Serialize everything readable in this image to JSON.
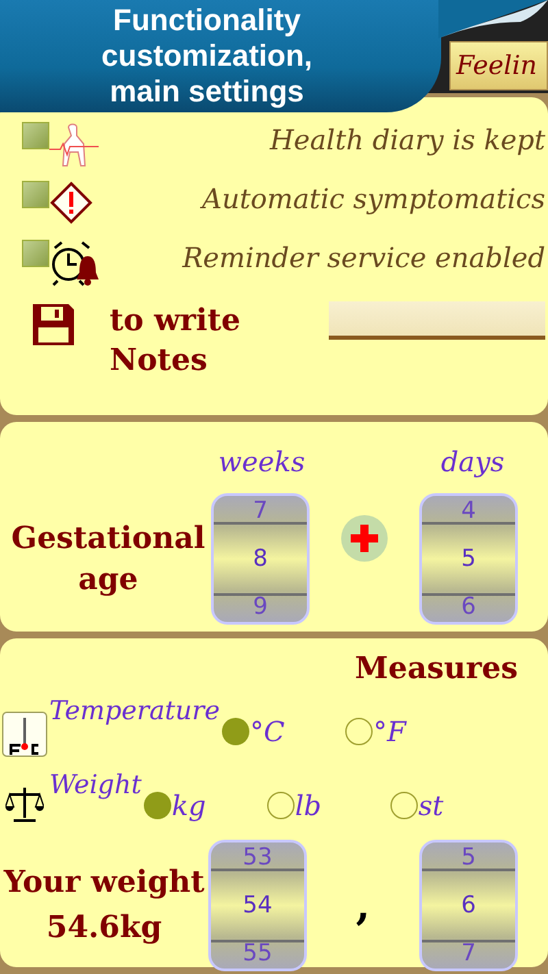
{
  "banner": {
    "title": "Functionality customization, main settings"
  },
  "tab": {
    "label": "Feelin"
  },
  "options": [
    {
      "kind": "diary",
      "label": "Health diary is kept",
      "checked": true
    },
    {
      "kind": "warning",
      "label": "Automatic symptomatics",
      "checked": true
    },
    {
      "kind": "alarm",
      "label": "Reminder service enabled",
      "checked": true
    }
  ],
  "notes": {
    "label": "to write Notes"
  },
  "gestation": {
    "label": "Gestational age",
    "weeks_label": "weeks",
    "days_label": "days",
    "weeks": [
      "7",
      "8",
      "9"
    ],
    "days": [
      "4",
      "5",
      "6"
    ]
  },
  "measures": {
    "title": "Measures",
    "groups": [
      {
        "kind": "temperature",
        "label": "Temperature",
        "options": [
          {
            "label": "°C",
            "selected": true
          },
          {
            "label": "°F",
            "selected": false
          }
        ]
      },
      {
        "kind": "weight",
        "label": "Weight",
        "options": [
          {
            "label": "kg",
            "selected": true
          },
          {
            "label": "lb",
            "selected": false
          },
          {
            "label": "st",
            "selected": false
          }
        ]
      }
    ],
    "weight_label": "Your weight",
    "weight_value": "54.6kg",
    "separator": ",",
    "whole": [
      "53",
      "54",
      "55"
    ],
    "fraction": [
      "5",
      "6",
      "7"
    ]
  }
}
